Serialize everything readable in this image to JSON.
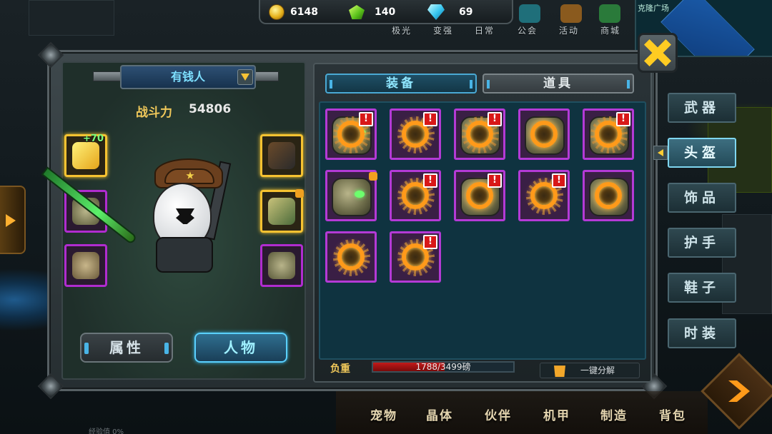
{
  "currency": {
    "gold": "6148",
    "green_gem": "140",
    "diamond": "69"
  },
  "top_nav": {
    "items": [
      "极光",
      "变强",
      "日常",
      "公会",
      "活动",
      "商城"
    ]
  },
  "minimap": {
    "title": "克隆广场"
  },
  "character": {
    "name": "有钱人",
    "power_label": "战斗力",
    "power_value": "54806",
    "enhance_badge": "+70"
  },
  "left_tabs": {
    "attributes": "属性",
    "character": "人物",
    "active": "character"
  },
  "inventory": {
    "tabs": [
      "装备",
      "道具"
    ],
    "active_tab": 0,
    "item_count": 12,
    "items": [
      {
        "type": "helmet-mask",
        "alert": true
      },
      {
        "type": "orange-ring",
        "alert": true
      },
      {
        "type": "orange-ring",
        "alert": true
      },
      {
        "type": "orange-ring",
        "alert": false
      },
      {
        "type": "orange-ring",
        "alert": true
      },
      {
        "type": "helmet-mask",
        "alert": false,
        "locked": true
      },
      {
        "type": "orange-ring",
        "alert": true
      },
      {
        "type": "orange-ring",
        "alert": true
      },
      {
        "type": "orange-ring",
        "alert": true
      },
      {
        "type": "orange-ring",
        "alert": false
      },
      {
        "type": "orange-ring",
        "alert": false
      },
      {
        "type": "orange-ring",
        "alert": true
      }
    ],
    "alert_mark": "!",
    "weight_label": "负重",
    "weight_text": "1788/3499磅",
    "weight_current": 1788,
    "weight_max": 3499,
    "decompose_label": "一键分解"
  },
  "categories": {
    "items": [
      "武器",
      "头盔",
      "饰品",
      "护手",
      "鞋子",
      "时装"
    ],
    "active": 1
  },
  "bottom_nav": {
    "items": [
      "宠物",
      "晶体",
      "伙伴",
      "机甲",
      "制造",
      "背包"
    ]
  },
  "exp_text": "经验值 0%",
  "colors": {
    "rarity_border": "#b43ad6",
    "legendary_border": "#f6c231",
    "accent": "#5ad0ff",
    "power_label": "#f0c85a"
  }
}
